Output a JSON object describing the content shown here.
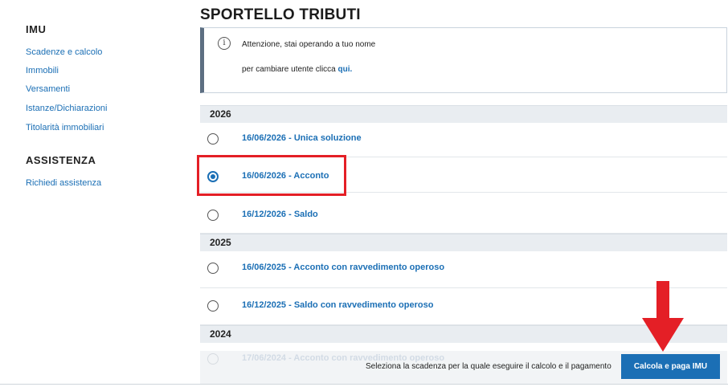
{
  "sidebar": {
    "imu_heading": "IMU",
    "imu_links": [
      {
        "label": "Scadenze e calcolo"
      },
      {
        "label": "Immobili"
      },
      {
        "label": "Versamenti"
      },
      {
        "label": "Istanze/Dichiarazioni"
      },
      {
        "label": "Titolarità immobiliari"
      }
    ],
    "assist_heading": "ASSISTENZA",
    "assist_links": [
      {
        "label": "Richiedi assistenza"
      }
    ]
  },
  "main": {
    "title": "SPORTELLO TRIBUTI",
    "notice": {
      "icon": "i",
      "line1": "Attenzione, stai operando a tuo nome",
      "line2_text": "per cambiare utente clicca ",
      "line2_link": "qui."
    },
    "groups": [
      {
        "year": "2026",
        "options": [
          {
            "label": "16/06/2026 - Unica soluzione",
            "checked": false
          },
          {
            "label": "16/06/2026 - Acconto",
            "checked": true
          },
          {
            "label": "16/12/2026 - Saldo",
            "checked": false
          }
        ]
      },
      {
        "year": "2025",
        "options": [
          {
            "label": "16/06/2025 - Acconto con ravvedimento operoso",
            "checked": false
          },
          {
            "label": "16/12/2025 - Saldo con ravvedimento operoso",
            "checked": false
          }
        ]
      },
      {
        "year": "2024",
        "options": [
          {
            "label": "17/06/2024 - Acconto con ravvedimento operoso",
            "checked": false
          }
        ]
      }
    ]
  },
  "footer": {
    "hint": "Seleziona la scadenza per la quale eseguire il calcolo e il pagamento",
    "button_label": "Calcola e paga IMU"
  },
  "colors": {
    "link_blue": "#1b6fb5",
    "annotation_red": "#e41f26",
    "year_bar_bg": "#e9edf1"
  }
}
